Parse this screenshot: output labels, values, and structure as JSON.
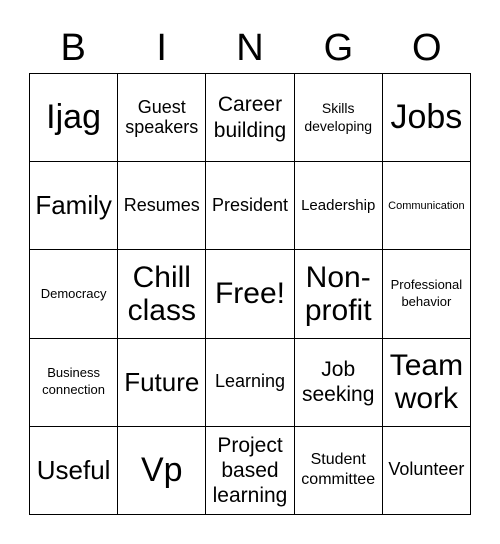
{
  "header": [
    "B",
    "I",
    "N",
    "G",
    "O"
  ],
  "cells": [
    [
      "Ijag",
      "Guest speakers",
      "Career building",
      "Skills developing",
      "Jobs"
    ],
    [
      "Family",
      "Resumes",
      "President",
      "Leadership",
      "Communication"
    ],
    [
      "Democracy",
      "Chill class",
      "Free!",
      "Non-profit",
      "Professional behavior"
    ],
    [
      "Business connection",
      "Future",
      "Learning",
      "Job seeking",
      "Team work"
    ],
    [
      "Useful",
      "Vp",
      "Project based learning",
      "Student committee",
      "Volunteer"
    ]
  ]
}
